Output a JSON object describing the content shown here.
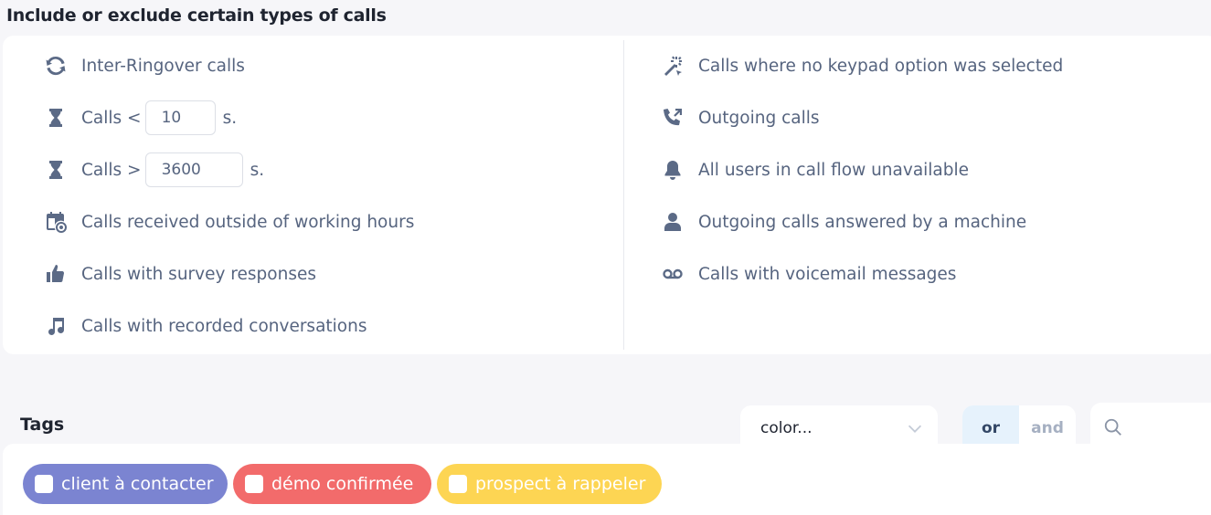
{
  "filters": {
    "title": "Include or exclude certain types of calls",
    "left_options": [
      {
        "icon": "sync-icon",
        "label": "Inter-Ringover calls"
      },
      {
        "icon": "hourglass-icon",
        "prefix": "Calls <",
        "value": "10",
        "suffix": "s."
      },
      {
        "icon": "hourglass-icon",
        "prefix": "Calls >",
        "value": "3600",
        "suffix": "s."
      },
      {
        "icon": "calendar-clock-icon",
        "label": "Calls received outside of working hours"
      },
      {
        "icon": "thumbs-up-icon",
        "label": "Calls with survey responses"
      },
      {
        "icon": "music-note-icon",
        "label": "Calls with recorded conversations"
      }
    ],
    "right_options": [
      {
        "icon": "magic-wand-icon",
        "label": "Calls where no keypad option was selected"
      },
      {
        "icon": "outgoing-call-icon",
        "label": "Outgoing calls"
      },
      {
        "icon": "bell-icon",
        "label": "All users in call flow unavailable"
      },
      {
        "icon": "user-icon",
        "label": "Outgoing calls answered by a machine"
      },
      {
        "icon": "voicemail-icon",
        "label": "Calls with voicemail messages"
      }
    ]
  },
  "tags": {
    "title": "Tags",
    "color_select": {
      "value": "color..."
    },
    "logic_toggle": {
      "or": "or",
      "and": "and",
      "selected": "or"
    },
    "items": [
      {
        "label": "client à contacter",
        "color": "#7b84d1"
      },
      {
        "label": "démo confirmée",
        "color": "#f26b6b"
      },
      {
        "label": "prospect à rappeler",
        "color": "#fdd553"
      }
    ]
  }
}
